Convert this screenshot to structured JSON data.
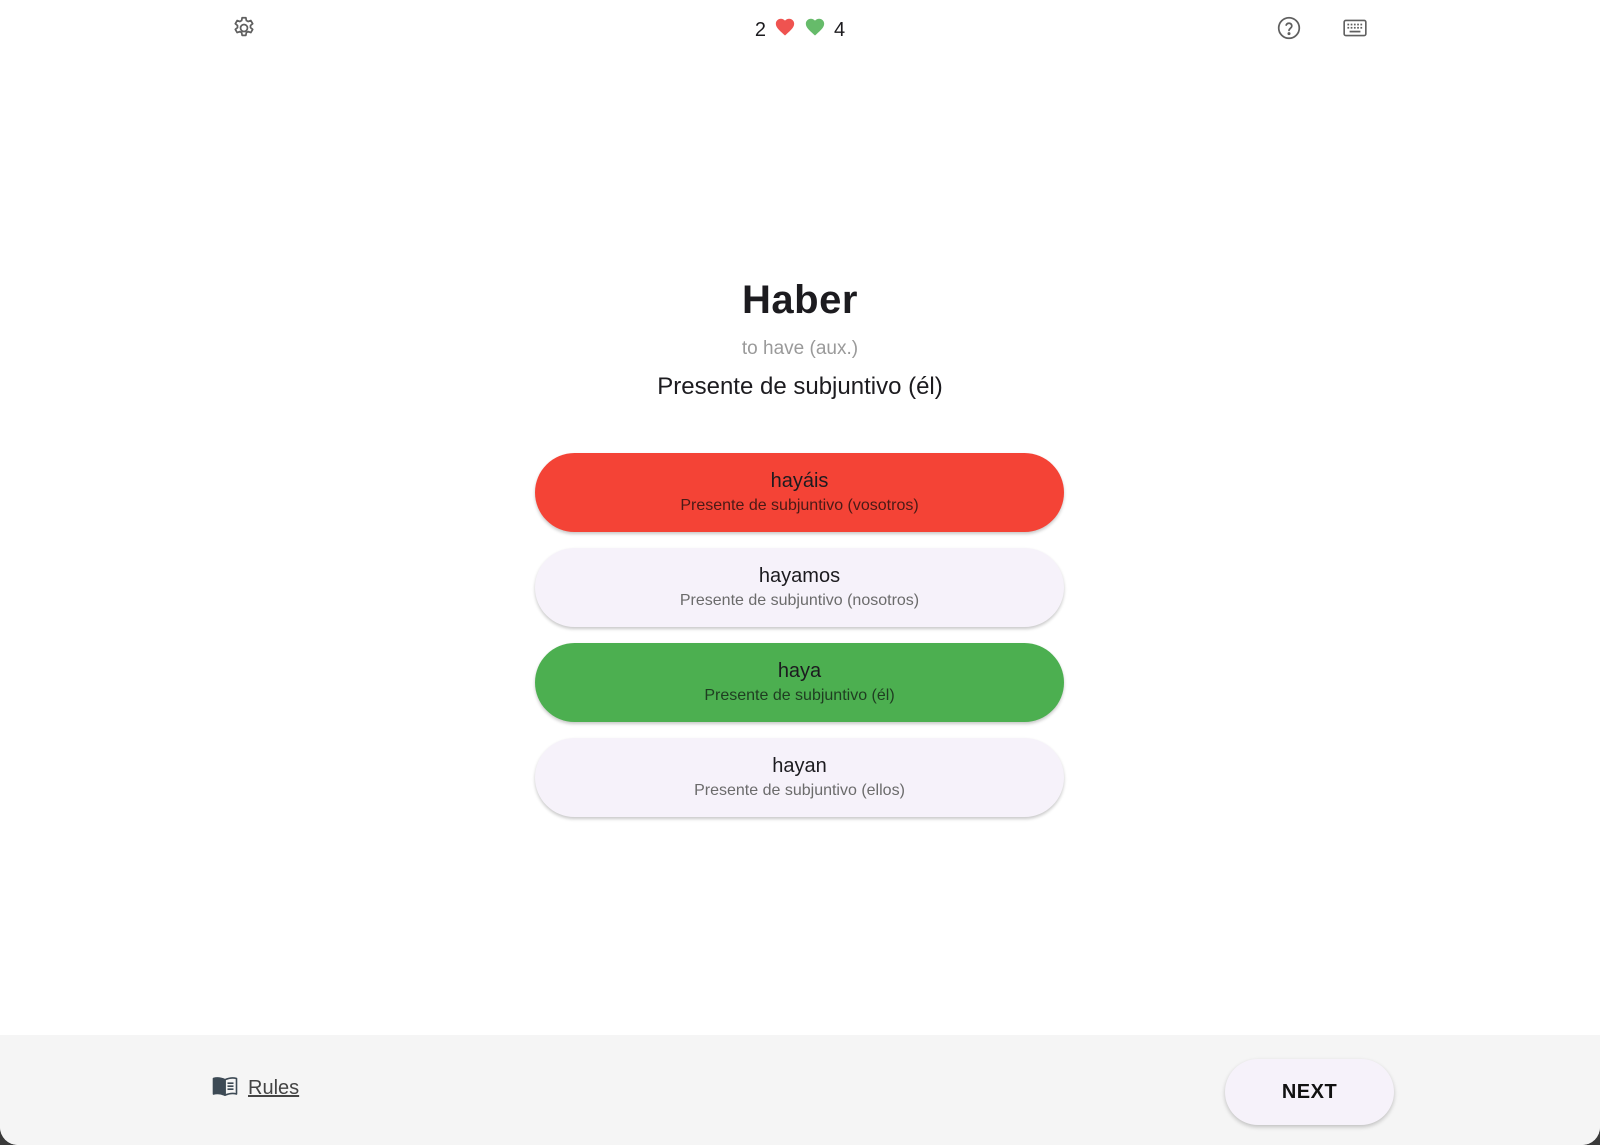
{
  "header": {
    "wrong_count": "2",
    "right_count": "4",
    "icons": {
      "settings": "gear-icon",
      "help": "help-circle-icon",
      "keyboard": "keyboard-icon",
      "wrong": "heart-icon",
      "right": "heart-icon"
    }
  },
  "quiz": {
    "verb": "Haber",
    "translation": "to have (aux.)",
    "prompt": "Presente de subjuntivo (él)",
    "options": [
      {
        "form": "hayáis",
        "desc": "Presente de subjuntivo (vosotros)",
        "state": "wrong"
      },
      {
        "form": "hayamos",
        "desc": "Presente de subjuntivo (nosotros)",
        "state": "neutral"
      },
      {
        "form": "haya",
        "desc": "Presente de subjuntivo (él)",
        "state": "correct"
      },
      {
        "form": "hayan",
        "desc": "Presente de subjuntivo (ellos)",
        "state": "neutral"
      }
    ]
  },
  "footer": {
    "rules_label": "Rules",
    "next_label": "NEXT",
    "rules_icon": "book-icon"
  },
  "colors": {
    "wrong": "#f44336",
    "correct": "#4caf50",
    "neutral": "#f6f2fa",
    "heart_wrong": "#ef5350",
    "heart_right": "#66bb6a"
  }
}
